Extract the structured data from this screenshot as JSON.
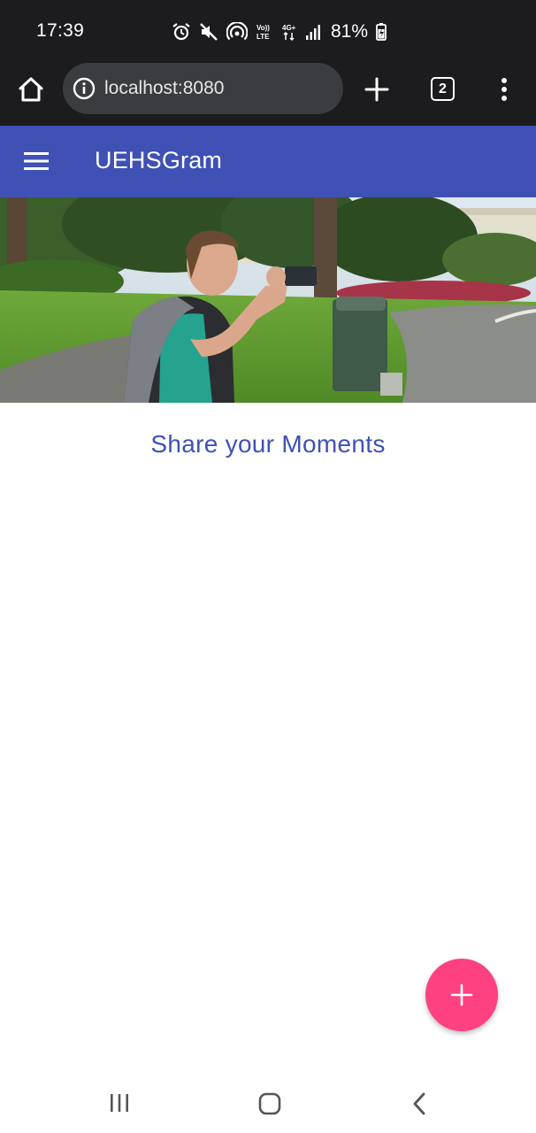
{
  "status_bar": {
    "time": "17:39",
    "battery": "81%",
    "icons": [
      "alarm-icon",
      "mute-icon",
      "hotspot-icon",
      "volte-icon",
      "4g-icon",
      "signal-icon",
      "battery-charging-icon"
    ]
  },
  "browser": {
    "url": "localhost:8080",
    "tab_count": "2"
  },
  "toolbar": {
    "title": "UEHSGram"
  },
  "main": {
    "headline": "Share your Moments"
  },
  "fab": {
    "label": "+"
  },
  "colors": {
    "primary": "#3f51b5",
    "accent": "#ff4081",
    "chrome": "#1c1c1e"
  }
}
